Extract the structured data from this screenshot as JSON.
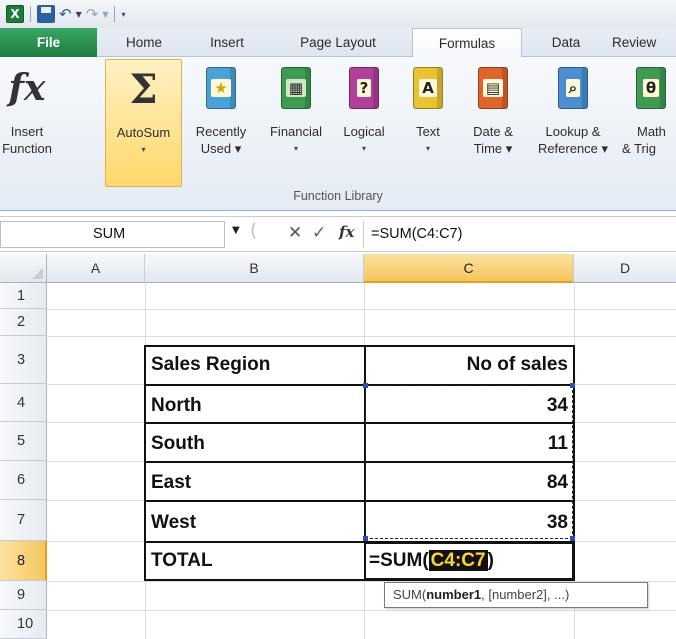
{
  "quick_access": {
    "app_icon": "excel-icon",
    "save_icon": "save-icon",
    "undo_icon": "undo-icon",
    "redo_icon": "redo-icon",
    "customize_icon": "customize-quick-access-icon"
  },
  "tabs": [
    "File",
    "Home",
    "Insert",
    "Page Layout",
    "Formulas",
    "Data",
    "Review"
  ],
  "active_tab": "Formulas",
  "ribbon": {
    "group_label": "Function Library",
    "buttons": [
      {
        "line1": "Insert",
        "line2": "Function",
        "caret": "",
        "icon": "insert-function-icon"
      },
      {
        "line1": "AutoSum",
        "line2": "▾",
        "caret": "",
        "icon": "sigma-icon"
      },
      {
        "line1": "Recently",
        "line2": "Used ▾",
        "caret": "",
        "icon": "recently-used-icon"
      },
      {
        "line1": "Financial",
        "line2": "▾",
        "caret": "",
        "icon": "financial-icon"
      },
      {
        "line1": "Logical",
        "line2": "▾",
        "caret": "",
        "icon": "logical-icon"
      },
      {
        "line1": "Text",
        "line2": "▾",
        "caret": "",
        "icon": "text-icon"
      },
      {
        "line1": "Date &",
        "line2": "Time ▾",
        "caret": "",
        "icon": "date-time-icon"
      },
      {
        "line1": "Lookup &",
        "line2": "Reference ▾",
        "caret": "",
        "icon": "lookup-reference-icon"
      },
      {
        "line1": "Math",
        "line2": "& Trig",
        "caret": "",
        "icon": "math-trig-icon"
      }
    ],
    "book_glyphs": {
      "logical": "?",
      "text": "A",
      "math": "θ"
    }
  },
  "formula_bar": {
    "name_box": "SUM",
    "fx_label": "fx",
    "cancel_glyph": "✕",
    "enter_glyph": "✓",
    "formula": "=SUM(C4:C7)"
  },
  "grid": {
    "columns": [
      "A",
      "B",
      "C",
      "D"
    ],
    "selected_column": "C",
    "rows": [
      "1",
      "2",
      "3",
      "4",
      "5",
      "6",
      "7",
      "8",
      "9",
      "10"
    ],
    "selected_row": "8"
  },
  "table": {
    "header": {
      "region": "Sales Region",
      "sales": "No of sales"
    },
    "rows": [
      {
        "region": "North",
        "sales": "34"
      },
      {
        "region": "South",
        "sales": "11"
      },
      {
        "region": "East",
        "sales": "84"
      },
      {
        "region": "West",
        "sales": "38"
      }
    ],
    "total_label": "TOTAL"
  },
  "active_cell": {
    "prefix": "=SUM(",
    "reference": "C4:C7",
    "suffix": ")"
  },
  "tooltip": {
    "fn": "SUM(",
    "arg1": "number1",
    "rest": ", [number2], ...)"
  },
  "colors": {
    "file_tab": "#1e7d40",
    "selection_header": "#f6c65c",
    "reference_highlight": "#ffd23a"
  }
}
